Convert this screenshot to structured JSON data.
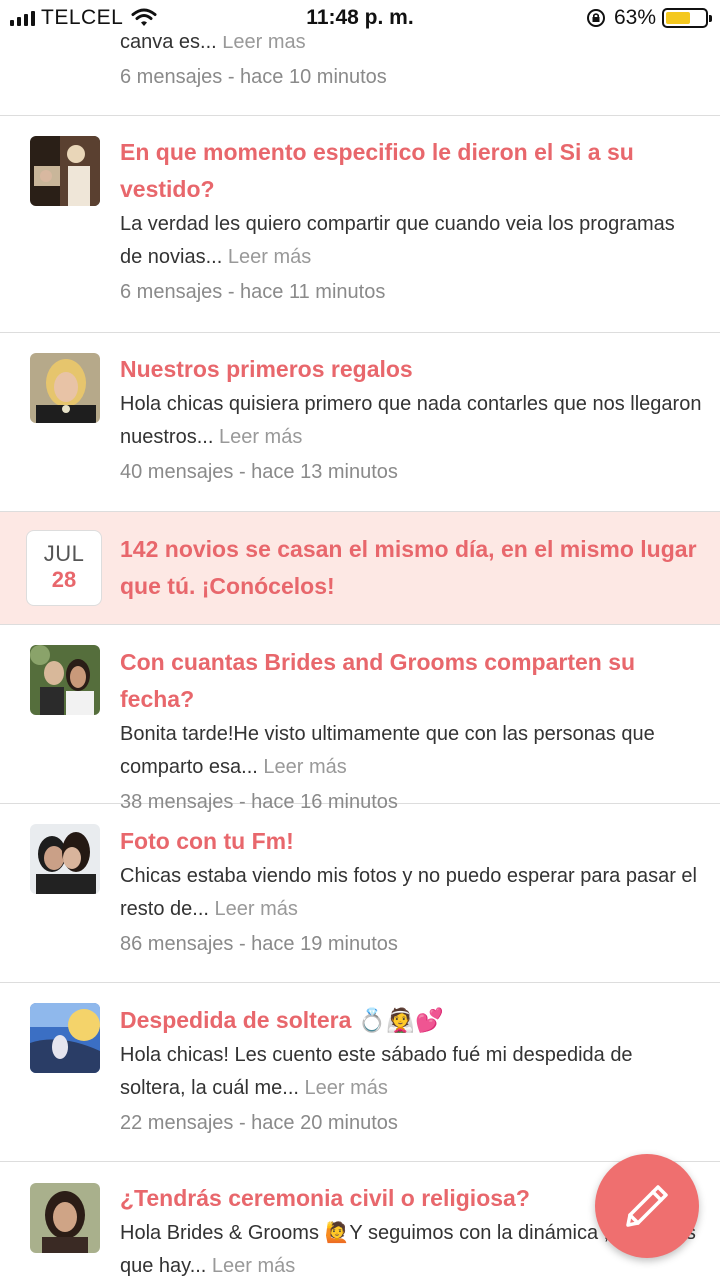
{
  "status_bar": {
    "carrier": "TELCEL",
    "time": "11:48 p. m.",
    "battery_percent": "63%",
    "battery_level": 0.63,
    "battery_color": "#f4c81f"
  },
  "colors": {
    "accent": "#e8676c",
    "promo_bg": "#fde8e4",
    "fab": "#ef6f6f"
  },
  "posts": [
    {
      "title": "",
      "excerpt": "canva es...",
      "read_more": "Leer más",
      "meta": "6 mensajes - hace 10 minutos"
    },
    {
      "title": "En que momento especifico le dieron el Si a su vestido?",
      "excerpt": "La verdad les quiero compartir que cuando veia los programas de novias...",
      "read_more": "Leer más",
      "meta": "6 mensajes - hace 11 minutos"
    },
    {
      "title": "Nuestros primeros regalos",
      "excerpt": "Hola chicas quisiera primero que nada contarles que nos llegaron nuestros...",
      "read_more": "Leer más",
      "meta": "40 mensajes - hace 13 minutos"
    },
    {
      "title": "Con cuantas Brides and Grooms comparten su fecha?",
      "excerpt": "Bonita tarde!He visto ultimamente que con las personas que comparto esa...",
      "read_more": "Leer más",
      "meta": "38 mensajes - hace 16 minutos"
    },
    {
      "title": "Foto con tu Fm!",
      "excerpt": "Chicas estaba viendo mis fotos y no puedo esperar para pasar el resto de...",
      "read_more": "Leer más",
      "meta": "86 mensajes - hace 19 minutos"
    },
    {
      "title": "Despedida de soltera 💍👰💕",
      "excerpt": "Hola chicas! Les cuento este sábado fué mi despedida de soltera, la cuál me...",
      "read_more": "Leer más",
      "meta": "22 mensajes - hace 20 minutos"
    },
    {
      "title": "¿Tendrás ceremonia civil o religiosa?",
      "excerpt": "Hola Brides & Grooms 🙋Y seguimos con la dinámica , sabemos que hay...",
      "read_more": "Leer más",
      "meta": ""
    }
  ],
  "promo": {
    "month": "JUL",
    "day": "28",
    "text": "142 novios se casan el mismo día, en el mismo lugar que tú. ¡Conócelos!"
  },
  "fab": {
    "icon": "pencil-icon"
  }
}
